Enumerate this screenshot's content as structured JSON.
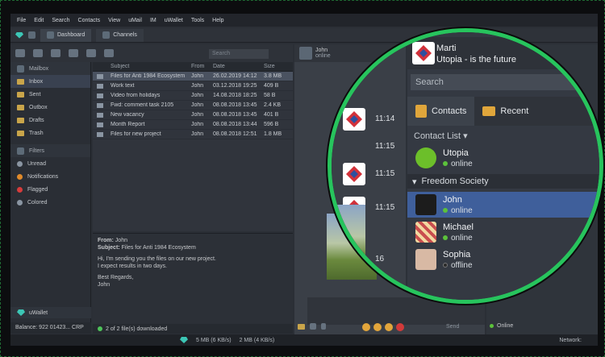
{
  "menu": [
    "File",
    "Edit",
    "Search",
    "Contacts",
    "View",
    "uMail",
    "IM",
    "uWallet",
    "Tools",
    "Help"
  ],
  "tabs": [
    {
      "label": "Dashboard"
    },
    {
      "label": "Channels"
    }
  ],
  "mail_search_placeholder": "Search",
  "sidebar": {
    "mailbox_header": "Mailbox",
    "items": [
      {
        "label": "Inbox"
      },
      {
        "label": "Sent"
      },
      {
        "label": "Outbox"
      },
      {
        "label": "Drafts"
      },
      {
        "label": "Trash"
      }
    ],
    "filters_header": "Filters",
    "filters": [
      {
        "label": "Unread",
        "color": "#8a95a2"
      },
      {
        "label": "Notifications",
        "color": "#e08a2a"
      },
      {
        "label": "Flagged",
        "color": "#d63c3c"
      },
      {
        "label": "Colored",
        "color": "#8a95a2"
      }
    ],
    "uwallet": "uWallet",
    "balance": "Balance: 922 01423... CRP"
  },
  "mail_table": {
    "headers": [
      "Subject",
      "From",
      "Date",
      "Size"
    ],
    "rows": [
      {
        "subject": "Files for Anti 1984 Ecosystem",
        "from": "John",
        "date": "26.02.2019 14:12",
        "size": "3.8 MB"
      },
      {
        "subject": "Work text",
        "from": "John",
        "date": "03.12.2018 19:25",
        "size": "409 B"
      },
      {
        "subject": "Video from holidays",
        "from": "John",
        "date": "14.08.2018 18:25",
        "size": "58 B"
      },
      {
        "subject": "Fwd: comment task 2105",
        "from": "John",
        "date": "08.08.2018 13:45",
        "size": "2.4 KB"
      },
      {
        "subject": "New vacancy",
        "from": "John",
        "date": "08.08.2018 13:45",
        "size": "401 B"
      },
      {
        "subject": "Month Report",
        "from": "John",
        "date": "08.08.2018 13:44",
        "size": "596 B"
      },
      {
        "subject": "Files for new project",
        "from": "John",
        "date": "08.08.2018 12:51",
        "size": "1.8 MB"
      }
    ]
  },
  "preview": {
    "from_label": "From:",
    "from_value": "John",
    "subject_label": "Subject:",
    "subject_value": "Files for Anti 1984 Ecosystem",
    "body1": "Hi, I'm sending you the files on our new project.",
    "body2": "I expect results in two days.",
    "body3": "Best Regards,",
    "body4": "John"
  },
  "download_status": "2 of 2 file(s) downloaded",
  "status_bar": {
    "up": "5 MB (6 KB/s)",
    "down": "2 MB (4 KB/s)",
    "network": "Network:"
  },
  "chat": {
    "name": "John",
    "status": "online",
    "send": "Send"
  },
  "right_panel_status": "Online",
  "lens": {
    "user_name": "Marti",
    "user_status": "Utopia - is the future",
    "search_placeholder": "Search",
    "tab_contacts": "Contacts",
    "tab_recent": "Recent",
    "contact_list_label": "Contact List",
    "times": [
      "11:14",
      "11:15",
      "11:15",
      "11:15",
      "16"
    ],
    "utopia": {
      "name": "Utopia",
      "status": "online"
    },
    "group": "Freedom Society",
    "contacts": [
      {
        "name": "John",
        "status": "online",
        "dot": "#5cc23b"
      },
      {
        "name": "Michael",
        "status": "online",
        "dot": "#5cc23b"
      },
      {
        "name": "Sophia",
        "status": "offline",
        "dot": "#2a2a2a"
      }
    ]
  }
}
